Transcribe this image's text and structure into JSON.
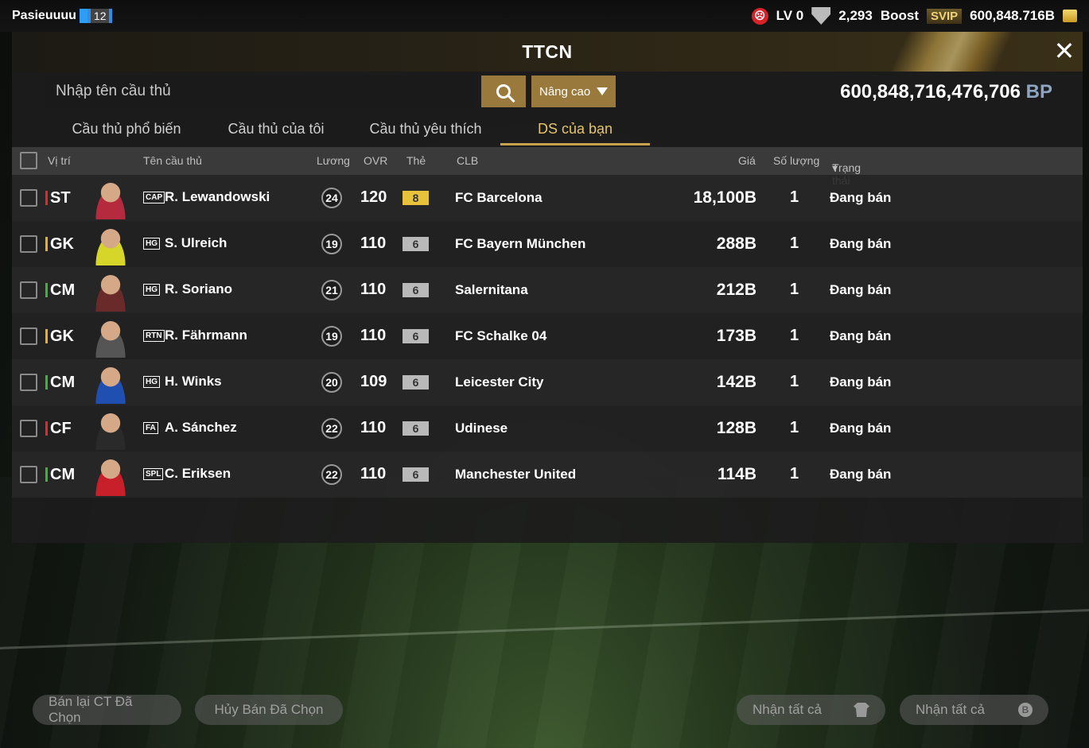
{
  "topbar": {
    "username": "Pasieuuuu",
    "level": "12",
    "lv": "LV 0",
    "trophies": "2,293",
    "boost_label": "Boost",
    "svip_label": "SVIP",
    "balance": "600,848.716B"
  },
  "header": {
    "title": "TTCN"
  },
  "search": {
    "placeholder": "Nhập tên cầu thủ",
    "advanced_label": "Nâng cao"
  },
  "bp": {
    "amount": "600,848,716,476,706",
    "unit": "BP"
  },
  "tabs": [
    {
      "label": "Cầu thủ phổ biến",
      "active": false
    },
    {
      "label": "Cầu thủ của tôi",
      "active": false
    },
    {
      "label": "Cầu thủ yêu thích",
      "active": false
    },
    {
      "label": "DS của bạn",
      "active": true
    }
  ],
  "table": {
    "headers": {
      "position": "Vị trí",
      "name": "Tên cầu thủ",
      "wage": "Lương",
      "ovr": "OVR",
      "card": "Thẻ",
      "club": "CLB",
      "price": "Giá",
      "quantity": "Số lượng",
      "status": "Trạng thái"
    },
    "rows": [
      {
        "pos": "ST",
        "pos_color": "#e0282e",
        "season": "CAP",
        "name": "R. Lewandowski",
        "wage": "24",
        "ovr": "120",
        "card": "8",
        "card_color": "#e8c23a",
        "club": "FC Barcelona",
        "price": "18,100B",
        "qty": "1",
        "status": "Đang bán",
        "kit": "#b52a3c"
      },
      {
        "pos": "GK",
        "pos_color": "#e8b02a",
        "season": "HG",
        "name": "S. Ulreich",
        "wage": "19",
        "ovr": "110",
        "card": "6",
        "card_color": "#b9b9b9",
        "club": "FC Bayern München",
        "price": "288B",
        "qty": "1",
        "status": "Đang bán",
        "kit": "#d6d62a"
      },
      {
        "pos": "CM",
        "pos_color": "#3cb43c",
        "season": "HG",
        "name": "R. Soriano",
        "wage": "21",
        "ovr": "110",
        "card": "6",
        "card_color": "#b9b9b9",
        "club": "Salernitana",
        "price": "212B",
        "qty": "1",
        "status": "Đang bán",
        "kit": "#6a2a2a"
      },
      {
        "pos": "GK",
        "pos_color": "#e8b02a",
        "season": "RTN",
        "name": "R. Fährmann",
        "wage": "19",
        "ovr": "110",
        "card": "6",
        "card_color": "#b9b9b9",
        "club": "FC Schalke 04",
        "price": "173B",
        "qty": "1",
        "status": "Đang bán",
        "kit": "#555555"
      },
      {
        "pos": "CM",
        "pos_color": "#3cb43c",
        "season": "HG",
        "name": "H. Winks",
        "wage": "20",
        "ovr": "109",
        "card": "6",
        "card_color": "#b9b9b9",
        "club": "Leicester City",
        "price": "142B",
        "qty": "1",
        "status": "Đang bán",
        "kit": "#1f4fb0"
      },
      {
        "pos": "CF",
        "pos_color": "#e0282e",
        "season": "FA",
        "name": "A. Sánchez",
        "wage": "22",
        "ovr": "110",
        "card": "6",
        "card_color": "#b9b9b9",
        "club": "Udinese",
        "price": "128B",
        "qty": "1",
        "status": "Đang bán",
        "kit": "#2a2a2a"
      },
      {
        "pos": "CM",
        "pos_color": "#3cb43c",
        "season": "SPL",
        "name": "C. Eriksen",
        "wage": "22",
        "ovr": "110",
        "card": "6",
        "card_color": "#b9b9b9",
        "club": "Manchester United",
        "price": "114B",
        "qty": "1",
        "status": "Đang bán",
        "kit": "#c8202a"
      }
    ]
  },
  "footer": {
    "resell_label": "Bán lại CT Đã Chọn",
    "cancel_label": "Hủy Bán Đã Chọn",
    "claim_all_1": "Nhận tất cả",
    "claim_all_2": "Nhận tất cả"
  }
}
